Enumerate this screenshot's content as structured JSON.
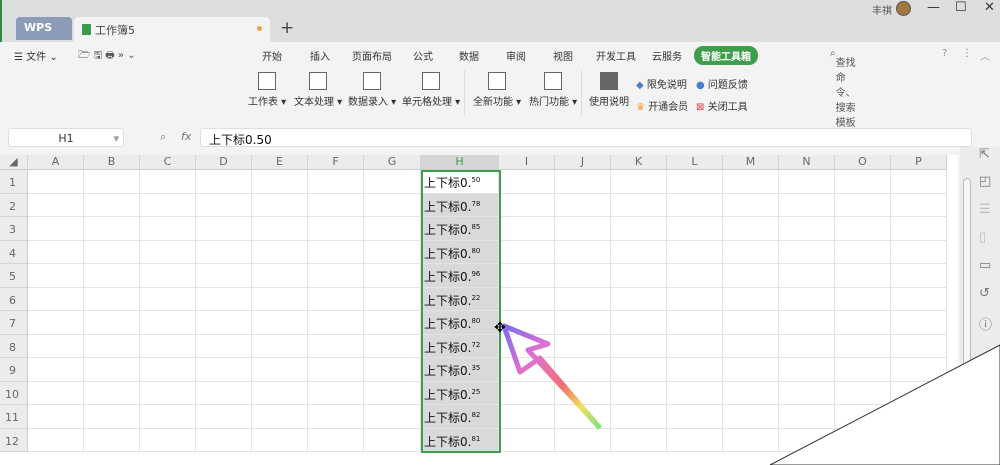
{
  "titlebar": {
    "wps_tab": "WPS",
    "doc_tab": "工作簿5",
    "new_tab": "+",
    "user": "丰祺",
    "minimize": "—",
    "maximize": "☐",
    "close": "✕"
  },
  "menu": {
    "file": "☰ 文件 ⌄",
    "quick": "🗁 🖫 🖶 » ⌄",
    "tabs": [
      "开始",
      "插入",
      "页面布局",
      "公式",
      "数据",
      "审阅",
      "视图",
      "开发工具",
      "云服务",
      "智能工具箱"
    ],
    "search": "查找命令、搜索模板",
    "help": "?",
    "more": "⋮",
    "collapse": "︿"
  },
  "ribbon": {
    "big": [
      "工作表",
      "文本处理",
      "数据录入",
      "单元格处理",
      "全新功能",
      "热门功能",
      "使用说明"
    ],
    "small": [
      "限免说明",
      "问题反馈",
      "开通会员",
      "关闭工具"
    ]
  },
  "formula": {
    "name_box": "H1",
    "fx": "fx",
    "value": "上下标0.50"
  },
  "columns": [
    "A",
    "B",
    "C",
    "D",
    "E",
    "F",
    "G",
    "H",
    "I",
    "J",
    "K",
    "L",
    "M",
    "N",
    "O",
    "P"
  ],
  "rows": [
    "1",
    "2",
    "3",
    "4",
    "5",
    "6",
    "7",
    "8",
    "9",
    "10",
    "11",
    "12"
  ],
  "cells": {
    "prefix": "上下标",
    "base": "0.",
    "sups": [
      "50",
      "78",
      "85",
      "80",
      "96",
      "22",
      "80",
      "72",
      "35",
      "25",
      "82",
      "81"
    ]
  },
  "colors": {
    "accent": "#3f9e4d"
  }
}
